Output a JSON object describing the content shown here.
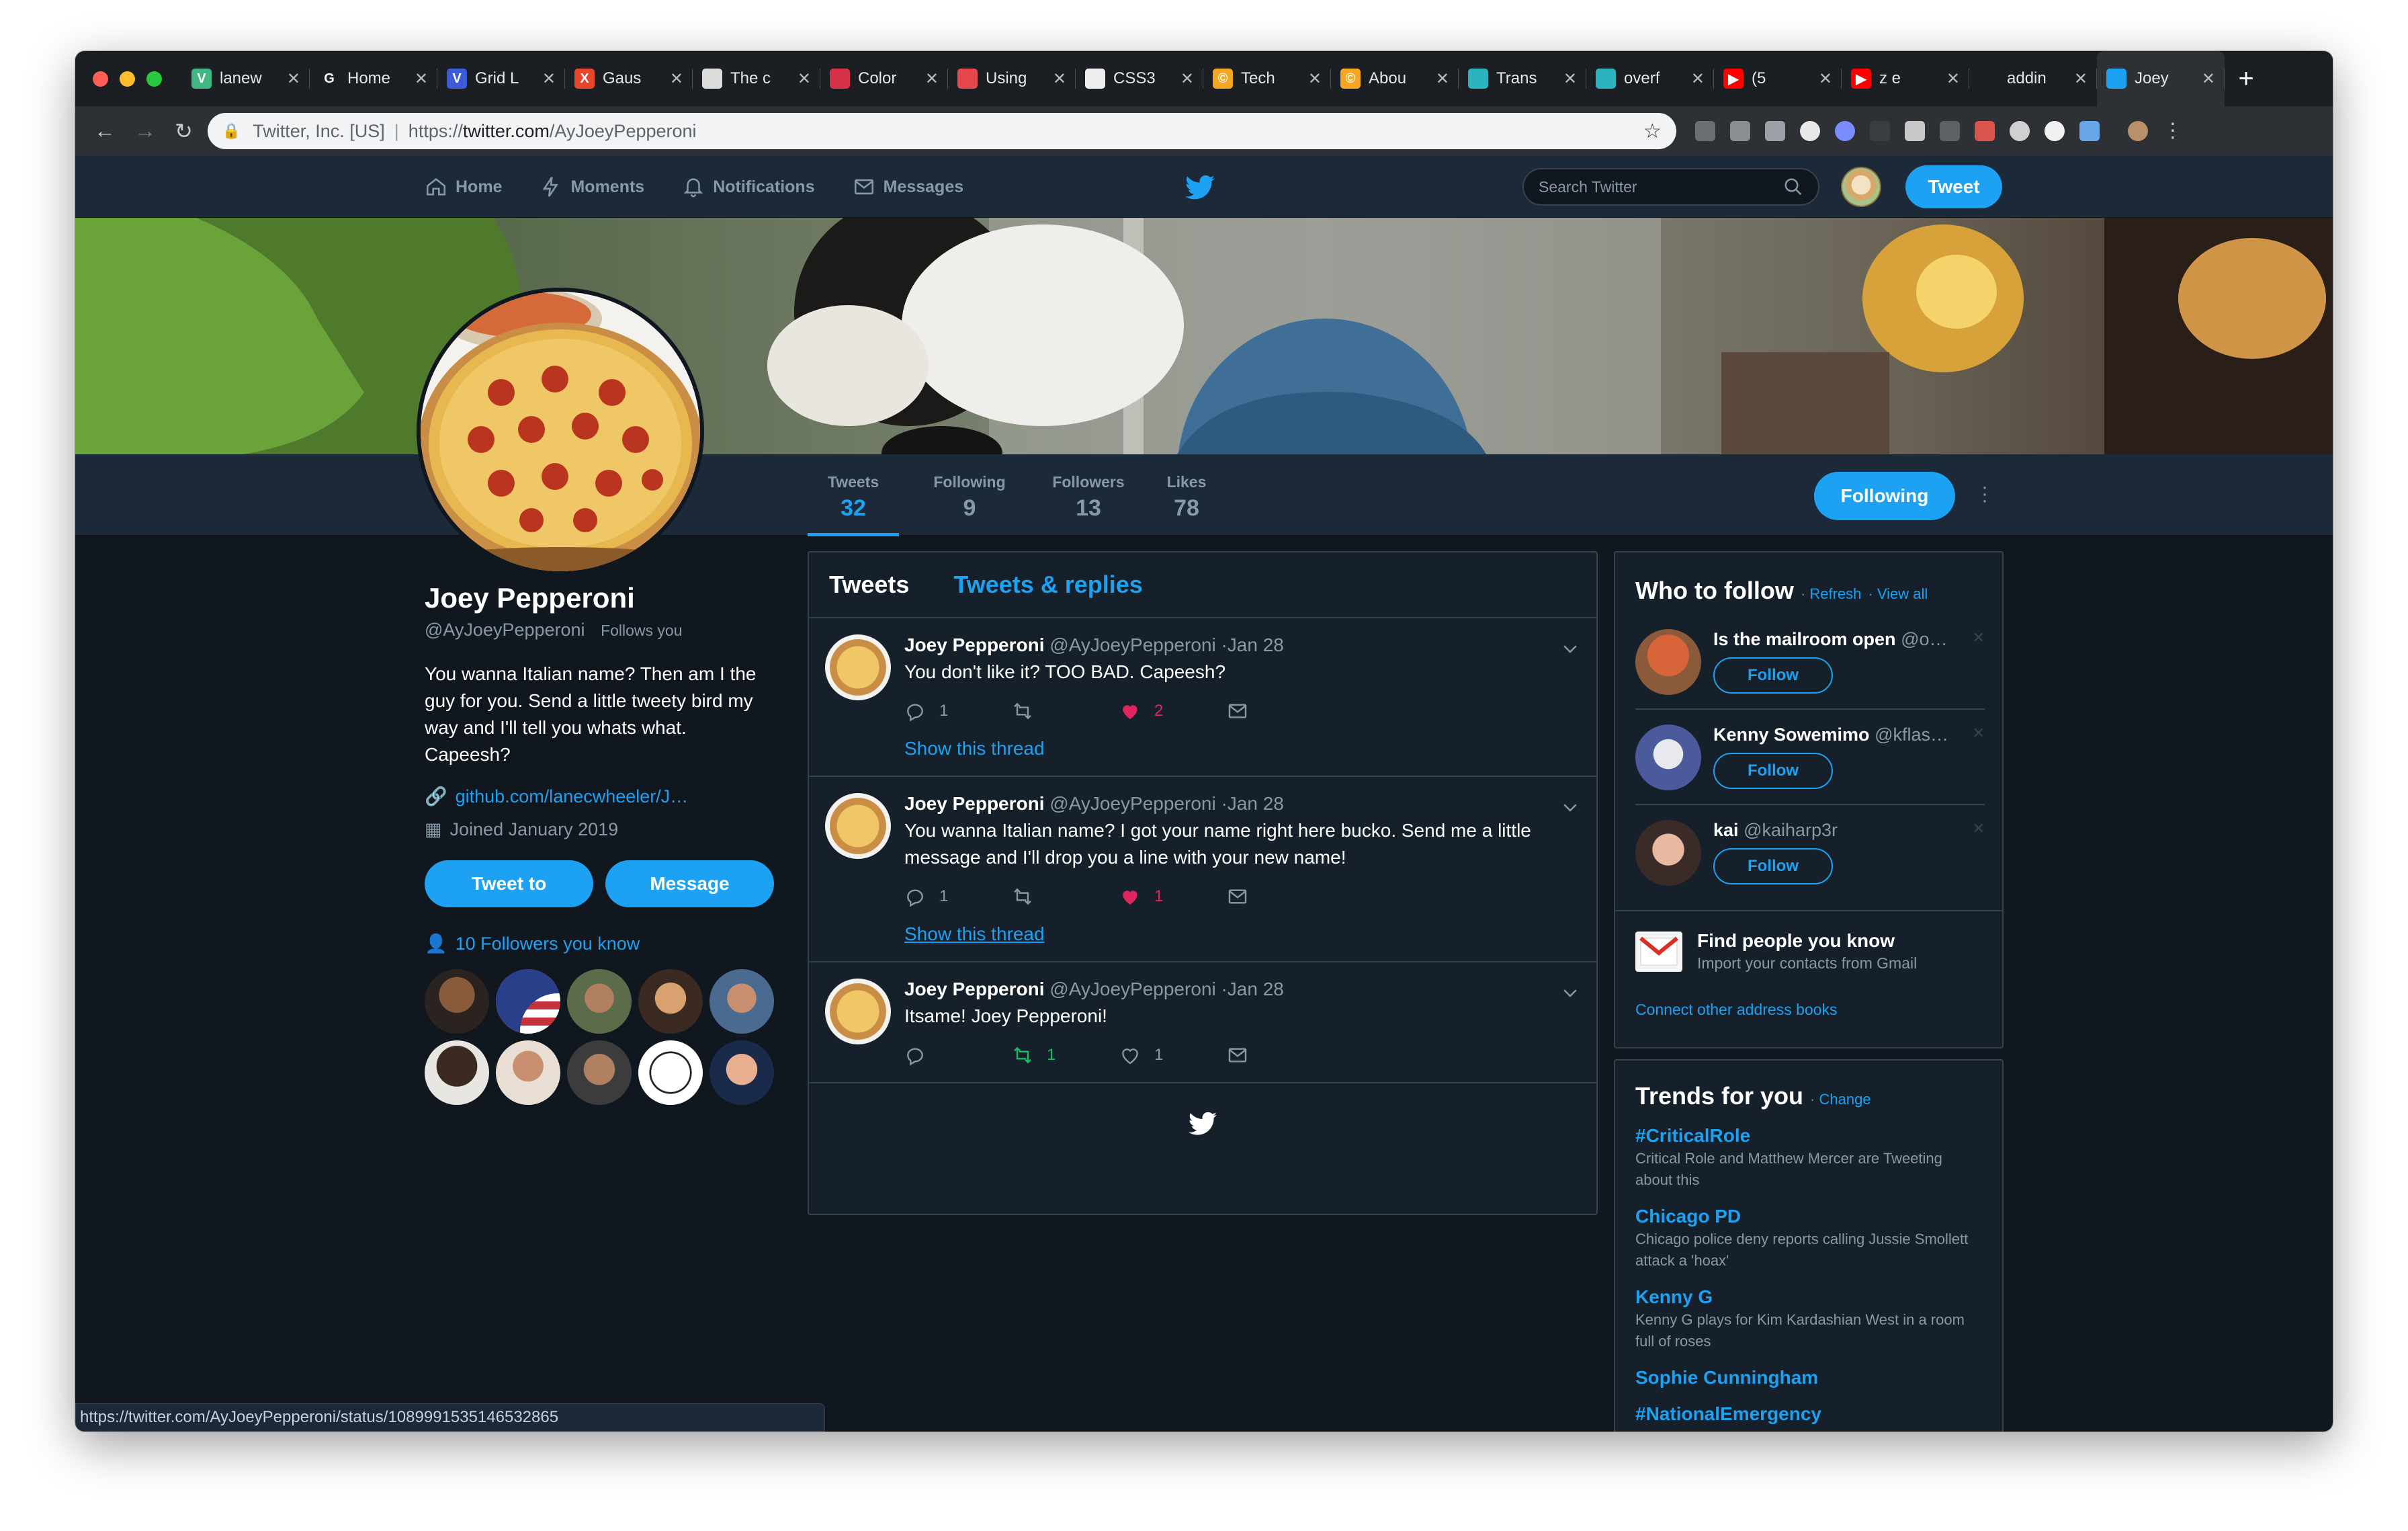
{
  "browser": {
    "tabs": [
      {
        "label": "lanew",
        "fav_color": "#41b883",
        "fav_glyph": "V"
      },
      {
        "label": "Home",
        "fav_color": "#1b1e22",
        "fav_glyph": "G"
      },
      {
        "label": "Grid L",
        "fav_color": "#3b5bdb",
        "fav_glyph": "V"
      },
      {
        "label": "Gaus",
        "fav_color": "#e8452c",
        "fav_glyph": "X"
      },
      {
        "label": "The c",
        "fav_color": "#dddddd",
        "fav_glyph": ""
      },
      {
        "label": "Color",
        "fav_color": "#d6334b",
        "fav_glyph": ""
      },
      {
        "label": "Using",
        "fav_color": "#e5484d",
        "fav_glyph": ""
      },
      {
        "label": "CSS3",
        "fav_color": "#eeeeee",
        "fav_glyph": ""
      },
      {
        "label": "Tech",
        "fav_color": "#f5a623",
        "fav_glyph": "©"
      },
      {
        "label": "Abou",
        "fav_color": "#f5a623",
        "fav_glyph": "©"
      },
      {
        "label": "Trans",
        "fav_color": "#2bb3c0",
        "fav_glyph": ""
      },
      {
        "label": "overf",
        "fav_color": "#2bb3c0",
        "fav_glyph": ""
      },
      {
        "label": "(5",
        "fav_color": "#ff0000",
        "fav_glyph": "▶"
      },
      {
        "label": "z e",
        "fav_color": "#ff0000",
        "fav_glyph": "▶"
      },
      {
        "label": "addin",
        "fav_color": "#1b1e22",
        "fav_glyph": ""
      },
      {
        "label": "Joey",
        "fav_color": "#1da1f2",
        "fav_glyph": "",
        "active": true
      }
    ],
    "site_identity": "Twitter, Inc. [US]",
    "url_prefix": "https://",
    "url_host": "twitter.com",
    "url_path": "/AyJoeyPepperoni",
    "status_url": "https://twitter.com/AyJoeyPepperoni/status/1089991535146532865"
  },
  "twitter_nav": {
    "items": [
      {
        "label": "Home",
        "icon": "home-icon"
      },
      {
        "label": "Moments",
        "icon": "moments-icon"
      },
      {
        "label": "Notifications",
        "icon": "bell-icon"
      },
      {
        "label": "Messages",
        "icon": "envelope-icon"
      }
    ],
    "search_placeholder": "Search Twitter",
    "tweet_button": "Tweet"
  },
  "stats": [
    {
      "label": "Tweets",
      "value": "32",
      "selected": true
    },
    {
      "label": "Following",
      "value": "9"
    },
    {
      "label": "Followers",
      "value": "13"
    },
    {
      "label": "Likes",
      "value": "78"
    }
  ],
  "following_button": "Following",
  "profile": {
    "name": "Joey Pepperoni",
    "handle": "@AyJoeyPepperoni",
    "follows_you": "Follows you",
    "bio": "You wanna Italian name? Then am I the guy for you. Send a little tweety bird my way and I'll tell you whats what. Capeesh?",
    "link": "github.com/lanecwheeler/J…",
    "joined": "Joined January 2019",
    "tweet_to": "Tweet to",
    "message": "Message",
    "followers_you_know": "10 Followers you know"
  },
  "timeline": {
    "tab_tweets": "Tweets",
    "tab_replies": "Tweets & replies",
    "tweets": [
      {
        "name": "Joey Pepperoni",
        "handle": "@AyJoeyPepperoni",
        "date": "·Jan 28",
        "text": "You don't like it? TOO BAD. Capeesh?",
        "replies": "1",
        "retweets": "",
        "likes": "2",
        "thread": "Show this thread"
      },
      {
        "name": "Joey Pepperoni",
        "handle": "@AyJoeyPepperoni",
        "date": "·Jan 28",
        "text": "You wanna Italian name? I got your name right here bucko. Send me a little message and I'll drop you a line with your new name!",
        "replies": "1",
        "retweets": "",
        "likes": "1",
        "thread": "Show this thread"
      },
      {
        "name": "Joey Pepperoni",
        "handle": "@AyJoeyPepperoni",
        "date": "·Jan 28",
        "text": "Itsame! Joey Pepperoni!",
        "replies": "",
        "retweets": "1",
        "likes": "1",
        "thread": ""
      }
    ]
  },
  "who_to_follow": {
    "title": "Who to follow",
    "refresh": "· Refresh",
    "view_all": "· View all",
    "suggestions": [
      {
        "name": "Is the mailroom open",
        "handle": "@o…",
        "button": "Follow"
      },
      {
        "name": "Kenny Sowemimo",
        "handle": "@kflas…",
        "button": "Follow"
      },
      {
        "name": "kai",
        "handle": "@kaiharp3r",
        "button": "Follow"
      }
    ],
    "find_title": "Find people you know",
    "find_sub": "Import your contacts from Gmail",
    "connect": "Connect other address books"
  },
  "trends": {
    "title": "Trends for you",
    "change": "· Change",
    "items": [
      {
        "name": "#CriticalRole",
        "desc": "Critical Role and Matthew Mercer are Tweeting about this"
      },
      {
        "name": "Chicago PD",
        "desc": "Chicago police deny reports calling Jussie Smollett attack a 'hoax'"
      },
      {
        "name": "Kenny G",
        "desc": "Kenny G plays for Kim Kardashian West in a room full of roses"
      },
      {
        "name": "Sophie Cunningham",
        "desc": ""
      },
      {
        "name": "#NationalEmergency",
        "desc": ""
      }
    ]
  }
}
